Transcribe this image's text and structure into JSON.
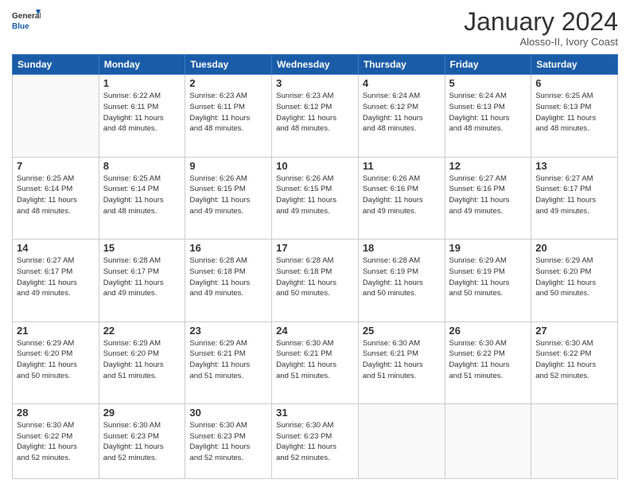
{
  "logo": {
    "line1": "General",
    "line2": "Blue"
  },
  "title": "January 2024",
  "subtitle": "Alosso-II, Ivory Coast",
  "headers": [
    "Sunday",
    "Monday",
    "Tuesday",
    "Wednesday",
    "Thursday",
    "Friday",
    "Saturday"
  ],
  "weeks": [
    [
      {
        "day": "",
        "info": ""
      },
      {
        "day": "1",
        "info": "Sunrise: 6:22 AM\nSunset: 6:11 PM\nDaylight: 11 hours\nand 48 minutes."
      },
      {
        "day": "2",
        "info": "Sunrise: 6:23 AM\nSunset: 6:11 PM\nDaylight: 11 hours\nand 48 minutes."
      },
      {
        "day": "3",
        "info": "Sunrise: 6:23 AM\nSunset: 6:12 PM\nDaylight: 11 hours\nand 48 minutes."
      },
      {
        "day": "4",
        "info": "Sunrise: 6:24 AM\nSunset: 6:12 PM\nDaylight: 11 hours\nand 48 minutes."
      },
      {
        "day": "5",
        "info": "Sunrise: 6:24 AM\nSunset: 6:13 PM\nDaylight: 11 hours\nand 48 minutes."
      },
      {
        "day": "6",
        "info": "Sunrise: 6:25 AM\nSunset: 6:13 PM\nDaylight: 11 hours\nand 48 minutes."
      }
    ],
    [
      {
        "day": "7",
        "info": "Sunrise: 6:25 AM\nSunset: 6:14 PM\nDaylight: 11 hours\nand 48 minutes."
      },
      {
        "day": "8",
        "info": "Sunrise: 6:25 AM\nSunset: 6:14 PM\nDaylight: 11 hours\nand 48 minutes."
      },
      {
        "day": "9",
        "info": "Sunrise: 6:26 AM\nSunset: 6:15 PM\nDaylight: 11 hours\nand 49 minutes."
      },
      {
        "day": "10",
        "info": "Sunrise: 6:26 AM\nSunset: 6:15 PM\nDaylight: 11 hours\nand 49 minutes."
      },
      {
        "day": "11",
        "info": "Sunrise: 6:26 AM\nSunset: 6:16 PM\nDaylight: 11 hours\nand 49 minutes."
      },
      {
        "day": "12",
        "info": "Sunrise: 6:27 AM\nSunset: 6:16 PM\nDaylight: 11 hours\nand 49 minutes."
      },
      {
        "day": "13",
        "info": "Sunrise: 6:27 AM\nSunset: 6:17 PM\nDaylight: 11 hours\nand 49 minutes."
      }
    ],
    [
      {
        "day": "14",
        "info": "Sunrise: 6:27 AM\nSunset: 6:17 PM\nDaylight: 11 hours\nand 49 minutes."
      },
      {
        "day": "15",
        "info": "Sunrise: 6:28 AM\nSunset: 6:17 PM\nDaylight: 11 hours\nand 49 minutes."
      },
      {
        "day": "16",
        "info": "Sunrise: 6:28 AM\nSunset: 6:18 PM\nDaylight: 11 hours\nand 49 minutes."
      },
      {
        "day": "17",
        "info": "Sunrise: 6:28 AM\nSunset: 6:18 PM\nDaylight: 11 hours\nand 50 minutes."
      },
      {
        "day": "18",
        "info": "Sunrise: 6:28 AM\nSunset: 6:19 PM\nDaylight: 11 hours\nand 50 minutes."
      },
      {
        "day": "19",
        "info": "Sunrise: 6:29 AM\nSunset: 6:19 PM\nDaylight: 11 hours\nand 50 minutes."
      },
      {
        "day": "20",
        "info": "Sunrise: 6:29 AM\nSunset: 6:20 PM\nDaylight: 11 hours\nand 50 minutes."
      }
    ],
    [
      {
        "day": "21",
        "info": "Sunrise: 6:29 AM\nSunset: 6:20 PM\nDaylight: 11 hours\nand 50 minutes."
      },
      {
        "day": "22",
        "info": "Sunrise: 6:29 AM\nSunset: 6:20 PM\nDaylight: 11 hours\nand 51 minutes."
      },
      {
        "day": "23",
        "info": "Sunrise: 6:29 AM\nSunset: 6:21 PM\nDaylight: 11 hours\nand 51 minutes."
      },
      {
        "day": "24",
        "info": "Sunrise: 6:30 AM\nSunset: 6:21 PM\nDaylight: 11 hours\nand 51 minutes."
      },
      {
        "day": "25",
        "info": "Sunrise: 6:30 AM\nSunset: 6:21 PM\nDaylight: 11 hours\nand 51 minutes."
      },
      {
        "day": "26",
        "info": "Sunrise: 6:30 AM\nSunset: 6:22 PM\nDaylight: 11 hours\nand 51 minutes."
      },
      {
        "day": "27",
        "info": "Sunrise: 6:30 AM\nSunset: 6:22 PM\nDaylight: 11 hours\nand 52 minutes."
      }
    ],
    [
      {
        "day": "28",
        "info": "Sunrise: 6:30 AM\nSunset: 6:22 PM\nDaylight: 11 hours\nand 52 minutes."
      },
      {
        "day": "29",
        "info": "Sunrise: 6:30 AM\nSunset: 6:23 PM\nDaylight: 11 hours\nand 52 minutes."
      },
      {
        "day": "30",
        "info": "Sunrise: 6:30 AM\nSunset: 6:23 PM\nDaylight: 11 hours\nand 52 minutes."
      },
      {
        "day": "31",
        "info": "Sunrise: 6:30 AM\nSunset: 6:23 PM\nDaylight: 11 hours\nand 52 minutes."
      },
      {
        "day": "",
        "info": ""
      },
      {
        "day": "",
        "info": ""
      },
      {
        "day": "",
        "info": ""
      }
    ]
  ]
}
